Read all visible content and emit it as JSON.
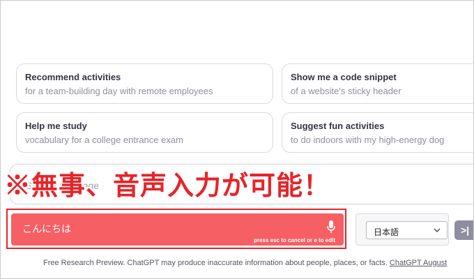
{
  "suggestions": [
    {
      "title": "Recommend activities",
      "subtitle": "for a team-building day with remote employees"
    },
    {
      "title": "Show me a code snippet",
      "subtitle": "of a website's sticky header"
    },
    {
      "title": "Help me study",
      "subtitle": "vocabulary for a college entrance exam"
    },
    {
      "title": "Suggest fun activities",
      "subtitle": "to do indoors with my high-energy dog"
    }
  ],
  "composer": {
    "placeholder": "Send a message"
  },
  "annotation": {
    "text": "※無事、音声入力が可能！",
    "color": "#e5252a"
  },
  "voice_input": {
    "text": "こんにちは",
    "hint": "press esc to cancel or e to edit",
    "mic_icon": "microphone-icon",
    "bar_color": "#f65f63"
  },
  "language": {
    "selected": "日本語"
  },
  "send_button": {
    "label": ">|",
    "icon": "send-icon"
  },
  "footer": {
    "text": "Free Research Preview. ChatGPT may produce inaccurate information about people, places, or facts. ",
    "link": "ChatGPT August"
  }
}
